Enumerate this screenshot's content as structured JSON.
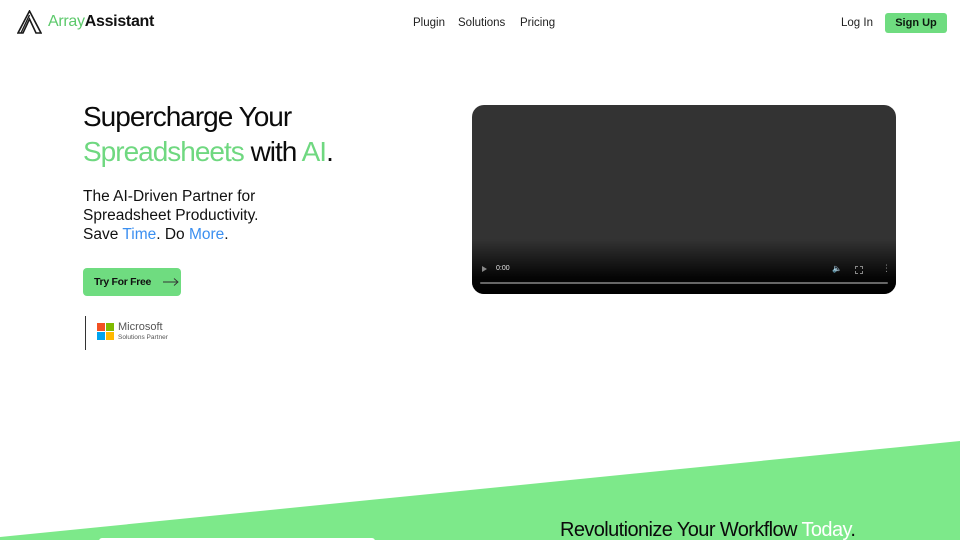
{
  "header": {
    "logo": {
      "icon": "array-assistant-logo-icon",
      "part1": "Array",
      "part2": "Assistant"
    },
    "nav": [
      {
        "label": "Plugin"
      },
      {
        "label": "Solutions"
      },
      {
        "label": "Pricing"
      }
    ],
    "login_label": "Log In",
    "signup_label": "Sign Up"
  },
  "hero": {
    "title_line1": "Supercharge Your",
    "title_green1": "Spreadsheets",
    "title_mid": " with ",
    "title_green2": "AI",
    "title_end": ".",
    "sub_line1": "The AI-Driven Partner for",
    "sub_line2": "Spreadsheet Productivity.",
    "sub_save": "Save ",
    "sub_time": "Time",
    "sub_do": ". Do ",
    "sub_more": "More",
    "sub_end": ".",
    "cta_label": "Try For Free",
    "cta_icon": "arrow-right-icon",
    "partner": {
      "name": "Microsoft",
      "subtitle": "Solutions Partner",
      "logo_colors": [
        "#f25022",
        "#7fba00",
        "#00a4ef",
        "#ffb900"
      ]
    }
  },
  "video": {
    "time": "0:00",
    "progress": 0
  },
  "bottom": {
    "title_main": "Revolutionize Your Workflow ",
    "title_highlight": "Today",
    "title_end": "."
  },
  "colors": {
    "brand_green": "#6fdc80",
    "band_green": "#7de98a",
    "accent_blue": "#3b8ff0",
    "text_dark": "#0b0b0b"
  }
}
